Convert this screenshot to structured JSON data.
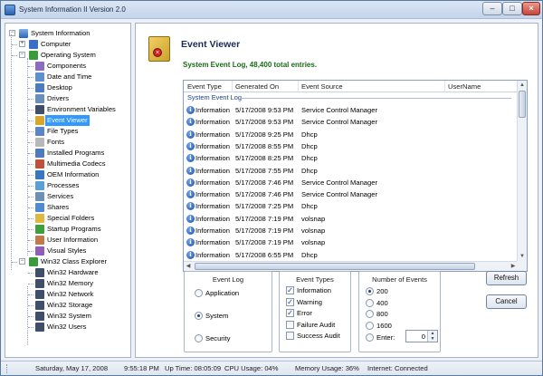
{
  "window": {
    "title": "System Information II Version 2.0",
    "minimize_label": "–",
    "maximize_label": "□",
    "close_label": "×"
  },
  "tree": {
    "root": "System Information",
    "items": [
      {
        "label": "Computer",
        "level": 1,
        "expander": "+",
        "icon_name": "computer-icon",
        "color": "#3a6fc6"
      },
      {
        "label": "Operating System",
        "level": 1,
        "expander": "−",
        "icon_name": "os-globe-icon",
        "color": "#3c9a3c"
      },
      {
        "label": "Components",
        "level": 2,
        "icon_name": "components-icon",
        "color": "#8a6cc0"
      },
      {
        "label": "Date and Time",
        "level": 2,
        "icon_name": "clock-icon",
        "color": "#5e8fd0"
      },
      {
        "label": "Desktop",
        "level": 2,
        "icon_name": "desktop-icon",
        "color": "#4b7cc2"
      },
      {
        "label": "Drivers",
        "level": 2,
        "icon_name": "drivers-icon",
        "color": "#6a8fb8"
      },
      {
        "label": "Environment Variables",
        "level": 2,
        "icon_name": "env-variables-icon",
        "color": "#3f4f6a"
      },
      {
        "label": "Event Viewer",
        "level": 2,
        "icon_name": "event-viewer-icon",
        "color": "#d9a52a",
        "selected": true
      },
      {
        "label": "File Types",
        "level": 2,
        "icon_name": "file-types-icon",
        "color": "#5a86c8"
      },
      {
        "label": "Fonts",
        "level": 2,
        "icon_name": "fonts-icon",
        "color": "#b8b8b8"
      },
      {
        "label": "Installed Programs",
        "level": 2,
        "icon_name": "installed-programs-icon",
        "color": "#4d7bbf"
      },
      {
        "label": "Multimedia Codecs",
        "level": 2,
        "icon_name": "codecs-icon",
        "color": "#c0503a"
      },
      {
        "label": "OEM Information",
        "level": 2,
        "icon_name": "oem-icon",
        "color": "#3a74c4"
      },
      {
        "label": "Processes",
        "level": 2,
        "icon_name": "processes-icon",
        "color": "#5a9fd8"
      },
      {
        "label": "Services",
        "level": 2,
        "icon_name": "services-gear-icon",
        "color": "#6e8fb8"
      },
      {
        "label": "Shares",
        "level": 2,
        "icon_name": "shares-icon",
        "color": "#4f8ad2"
      },
      {
        "label": "Special Folders",
        "level": 2,
        "icon_name": "folder-icon",
        "color": "#e0b840"
      },
      {
        "label": "Startup Programs",
        "level": 2,
        "icon_name": "startup-icon",
        "color": "#3da03d"
      },
      {
        "label": "User Information",
        "level": 2,
        "icon_name": "user-icon",
        "color": "#c27a4a"
      },
      {
        "label": "Visual Styles",
        "level": 2,
        "icon_name": "visual-styles-icon",
        "color": "#8f5fb8"
      },
      {
        "label": "Win32 Class Explorer",
        "level": 1,
        "expander": "−",
        "icon_name": "class-explorer-icon",
        "color": "#3c9a3c"
      },
      {
        "label": "Win32 Hardware",
        "level": 2,
        "icon_name": "hardware-icon",
        "color": "#3f4f6a"
      },
      {
        "label": "Win32 Memory",
        "level": 2,
        "icon_name": "memory-icon",
        "color": "#3f4f6a"
      },
      {
        "label": "Win32 Network",
        "level": 2,
        "icon_name": "network-icon",
        "color": "#3f4f6a"
      },
      {
        "label": "Win32 Storage",
        "level": 2,
        "icon_name": "storage-icon",
        "color": "#3f4f6a"
      },
      {
        "label": "Win32 System",
        "level": 2,
        "icon_name": "system-icon",
        "color": "#3f4f6a"
      },
      {
        "label": "Win32 Users",
        "level": 2,
        "icon_name": "users-icon",
        "color": "#3f4f6a"
      }
    ]
  },
  "panel": {
    "title": "Event Viewer",
    "subtitle": "System Event Log, 48,400 total entries."
  },
  "event_list": {
    "columns": [
      "Event Type",
      "Generated On",
      "Event Source",
      "UserName"
    ],
    "group_label": "System Event Log",
    "rows": [
      [
        "Information",
        "5/17/2008 9:53 PM",
        "Service Control Manager",
        ""
      ],
      [
        "Information",
        "5/17/2008 9:53 PM",
        "Service Control Manager",
        ""
      ],
      [
        "Information",
        "5/17/2008 9:25 PM",
        "Dhcp",
        ""
      ],
      [
        "Information",
        "5/17/2008 8:55 PM",
        "Dhcp",
        ""
      ],
      [
        "Information",
        "5/17/2008 8:25 PM",
        "Dhcp",
        ""
      ],
      [
        "Information",
        "5/17/2008 7:55 PM",
        "Dhcp",
        ""
      ],
      [
        "Information",
        "5/17/2008 7:46 PM",
        "Service Control Manager",
        ""
      ],
      [
        "Information",
        "5/17/2008 7:46 PM",
        "Service Control Manager",
        ""
      ],
      [
        "Information",
        "5/17/2008 7:25 PM",
        "Dhcp",
        ""
      ],
      [
        "Information",
        "5/17/2008 7:19 PM",
        "volsnap",
        ""
      ],
      [
        "Information",
        "5/17/2008 7:19 PM",
        "volsnap",
        ""
      ],
      [
        "Information",
        "5/17/2008 7:19 PM",
        "volsnap",
        ""
      ],
      [
        "Information",
        "5/17/2008 6:55 PM",
        "Dhcp",
        ""
      ]
    ]
  },
  "event_log_group": {
    "title": "Event Log",
    "options": [
      {
        "label": "Application",
        "selected": false
      },
      {
        "label": "System",
        "selected": true
      },
      {
        "label": "Security",
        "selected": false
      }
    ]
  },
  "event_types_group": {
    "title": "Event Types",
    "options": [
      {
        "label": "Information",
        "checked": true
      },
      {
        "label": "Warning",
        "checked": true
      },
      {
        "label": "Error",
        "checked": true
      },
      {
        "label": "Failure Audit",
        "checked": false
      },
      {
        "label": "Success Audit",
        "checked": false
      }
    ]
  },
  "number_of_events_group": {
    "title": "Number of Events",
    "options": [
      {
        "label": "200",
        "selected": true
      },
      {
        "label": "400",
        "selected": false
      },
      {
        "label": "800",
        "selected": false
      },
      {
        "label": "1600",
        "selected": false
      },
      {
        "label": "Enter:",
        "selected": false
      }
    ],
    "enter_value": "0"
  },
  "buttons": {
    "refresh": "Refresh",
    "cancel": "Cancel"
  },
  "status_bar": {
    "date": "Saturday, May 17, 2008",
    "time": "9:55:18 PM",
    "uptime": "Up Time: 08:05:09",
    "cpu": "CPU Usage: 04%",
    "memory": "Memory Usage: 36%",
    "internet": "Internet: Connected"
  }
}
